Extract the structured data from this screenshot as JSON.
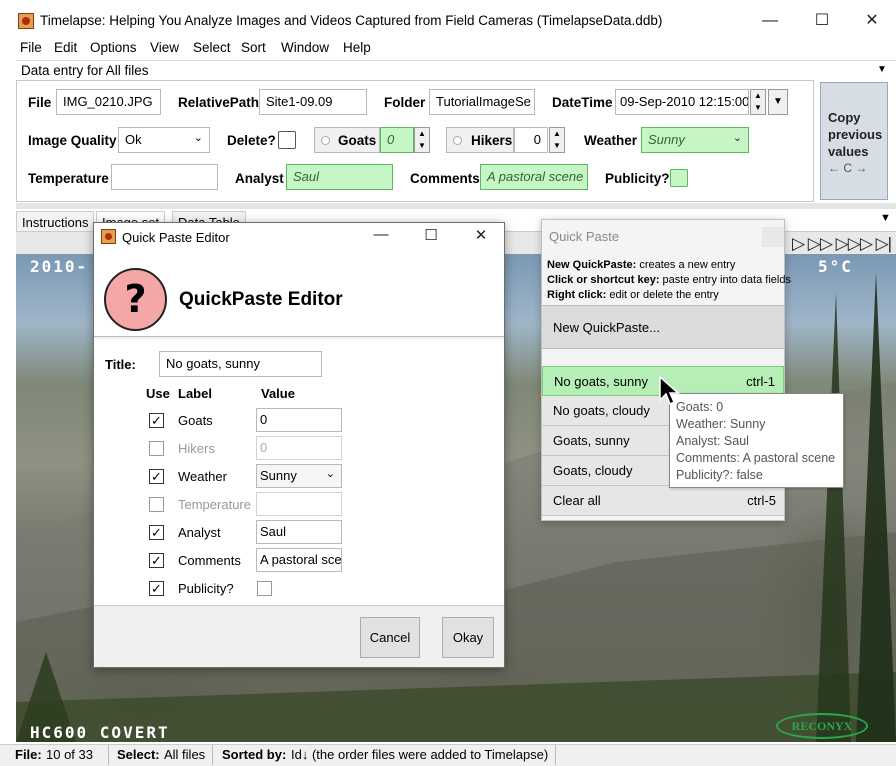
{
  "window": {
    "title": "Timelapse: Helping You Analyze Images and Videos Captured from Field Cameras (TimelapseData.ddb)",
    "minimize": "—",
    "maximize": "☐",
    "close": "✕"
  },
  "menu": [
    "File",
    "Edit",
    "Options",
    "View",
    "Select",
    "Sort",
    "Window",
    "Help"
  ],
  "data_entry": {
    "header": "Data entry for All files",
    "file_label": "File",
    "file_value": "IMG_0210.JPG",
    "relpath_label": "RelativePath",
    "relpath_value": "Site1-09.09",
    "folder_label": "Folder",
    "folder_value": "TutorialImageSe",
    "datetime_label": "DateTime",
    "datetime_value": "09-Sep-2010 12:15:00",
    "quality_label": "Image Quality",
    "quality_value": "Ok",
    "delete_label": "Delete?",
    "goats_label": "Goats",
    "goats_value": "0",
    "hikers_label": "Hikers",
    "hikers_value": "0",
    "weather_label": "Weather",
    "weather_value": "Sunny",
    "temperature_label": "Temperature",
    "temperature_value": "",
    "analyst_label": "Analyst",
    "analyst_value": "Saul",
    "comments_label": "Comments",
    "comments_value": "A pastoral scene",
    "publicity_label": "Publicity?",
    "copy_previous": "Copy previous values",
    "copy_previous_keys": "← C →"
  },
  "tabs": [
    "Instructions",
    "Image set",
    "Data Table"
  ],
  "image": {
    "stamp_date": "2010-",
    "stamp_temp": "5°C",
    "stamp_camera": "HC600 COVERT",
    "brand": "RECONYX",
    "nav_controls": "▷ ▷▷ ▷▷▷ ▷|"
  },
  "quick_paste_editor": {
    "window_title": "Quick Paste Editor",
    "heading": "QuickPaste Editor",
    "help_glyph": "?",
    "title_label": "Title:",
    "title_value": "No goats, sunny",
    "col_use": "Use",
    "col_label": "Label",
    "col_value": "Value",
    "rows": [
      {
        "label": "Goats",
        "value": "0",
        "use": true
      },
      {
        "label": "Hikers",
        "value": "0",
        "use": false
      },
      {
        "label": "Weather",
        "value": "Sunny",
        "use": true
      },
      {
        "label": "Temperature",
        "value": "",
        "use": false
      },
      {
        "label": "Analyst",
        "value": "Saul",
        "use": true
      },
      {
        "label": "Comments",
        "value": "A pastoral scene",
        "use": true
      },
      {
        "label": "Publicity?",
        "value": "",
        "use": true
      }
    ],
    "cancel": "Cancel",
    "okay": "Okay"
  },
  "quick_paste": {
    "title": "Quick Paste",
    "help": [
      {
        "bold": "New QuickPaste:",
        "text": " creates a new entry"
      },
      {
        "bold": "Click or shortcut key:",
        "text": " paste entry into data fields"
      },
      {
        "bold": "Right click:",
        "text": " edit or delete the entry"
      }
    ],
    "new_button": "New QuickPaste...",
    "items": [
      {
        "label": "No goats, sunny",
        "key": "ctrl-1",
        "selected": true
      },
      {
        "label": "No goats, cloudy",
        "key": "",
        "selected": false
      },
      {
        "label": "Goats, sunny",
        "key": "",
        "selected": false
      },
      {
        "label": "Goats, cloudy",
        "key": "",
        "selected": false
      },
      {
        "label": "Clear all",
        "key": "ctrl-5",
        "selected": false
      }
    ]
  },
  "tooltip": [
    "Goats: 0",
    "Weather: Sunny",
    "Analyst: Saul",
    "Comments: A pastoral scene",
    "Publicity?: false"
  ],
  "status": {
    "file_label": "File:",
    "file_value": "10 of 33",
    "select_label": "Select:",
    "select_value": "All files",
    "sorted_label": "Sorted by:",
    "sorted_value": "Id↓ (the order files were added to Timelapse)"
  },
  "colors": {
    "field_green": "#c6f5c6",
    "quickpaste_selected": "#b6efb6",
    "help_icon": "#f5a6a6",
    "brand_green": "#2aa84a"
  }
}
